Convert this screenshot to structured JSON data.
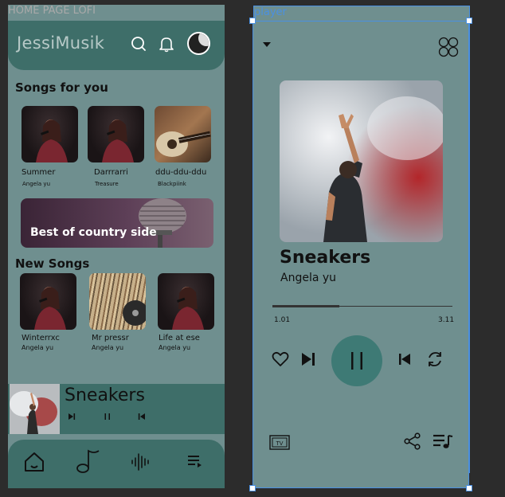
{
  "frames": {
    "home_label": "HOME PAGE LOFI",
    "player_label": "player"
  },
  "home": {
    "brand": "JessiMusik",
    "header_icons": [
      "search-icon",
      "bell-icon"
    ],
    "songs_for_you": {
      "title": "Songs for you",
      "items": [
        {
          "title": "Summer",
          "artist": "Angela yu"
        },
        {
          "title": "Darrrarri",
          "artist": "Treasure"
        },
        {
          "title": "ddu-ddu-ddu",
          "artist": "Blackpiink"
        }
      ]
    },
    "banner": {
      "text": "Best of country side"
    },
    "new_songs": {
      "title": "New Songs",
      "items": [
        {
          "title": "Winterrxc",
          "artist": "Angela yu"
        },
        {
          "title": "Mr pressr",
          "artist": "Angela yu"
        },
        {
          "title": "Life at ese",
          "artist": "Angela yu"
        }
      ]
    },
    "mini_player": {
      "title": "Sneakers"
    },
    "nav_icons": [
      "home-icon",
      "music-note-icon",
      "audio-wave-icon",
      "queue-icon"
    ]
  },
  "player": {
    "song_title": "Sneakers",
    "artist": "Angela yu",
    "current_time": "1.01",
    "duration": "3.11",
    "progress": 0.37,
    "colors": {
      "accent": "#3e7a75",
      "background": "#6f8f8f",
      "selection": "#4a90e2"
    }
  }
}
